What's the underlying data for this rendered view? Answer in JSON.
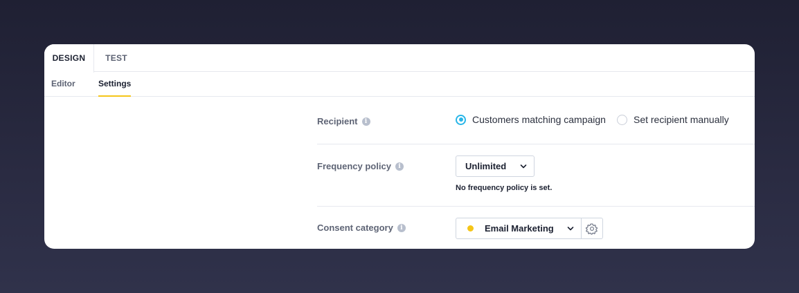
{
  "tabs": [
    {
      "label": "DESIGN",
      "active": true
    },
    {
      "label": "TEST",
      "active": false
    }
  ],
  "subtabs": [
    {
      "label": "Editor",
      "active": false
    },
    {
      "label": "Settings",
      "active": true
    }
  ],
  "recipient": {
    "label": "Recipient",
    "options": [
      {
        "label": "Customers matching campaign",
        "selected": true
      },
      {
        "label": "Set recipient manually",
        "selected": false
      }
    ]
  },
  "frequency": {
    "label": "Frequency policy",
    "value": "Unlimited",
    "note": "No frequency policy is set."
  },
  "consent": {
    "label": "Consent category",
    "value": "Email Marketing",
    "dot_color": "#f5c518"
  },
  "colors": {
    "accent": "#29b6e8",
    "highlight": "#f5c518"
  }
}
